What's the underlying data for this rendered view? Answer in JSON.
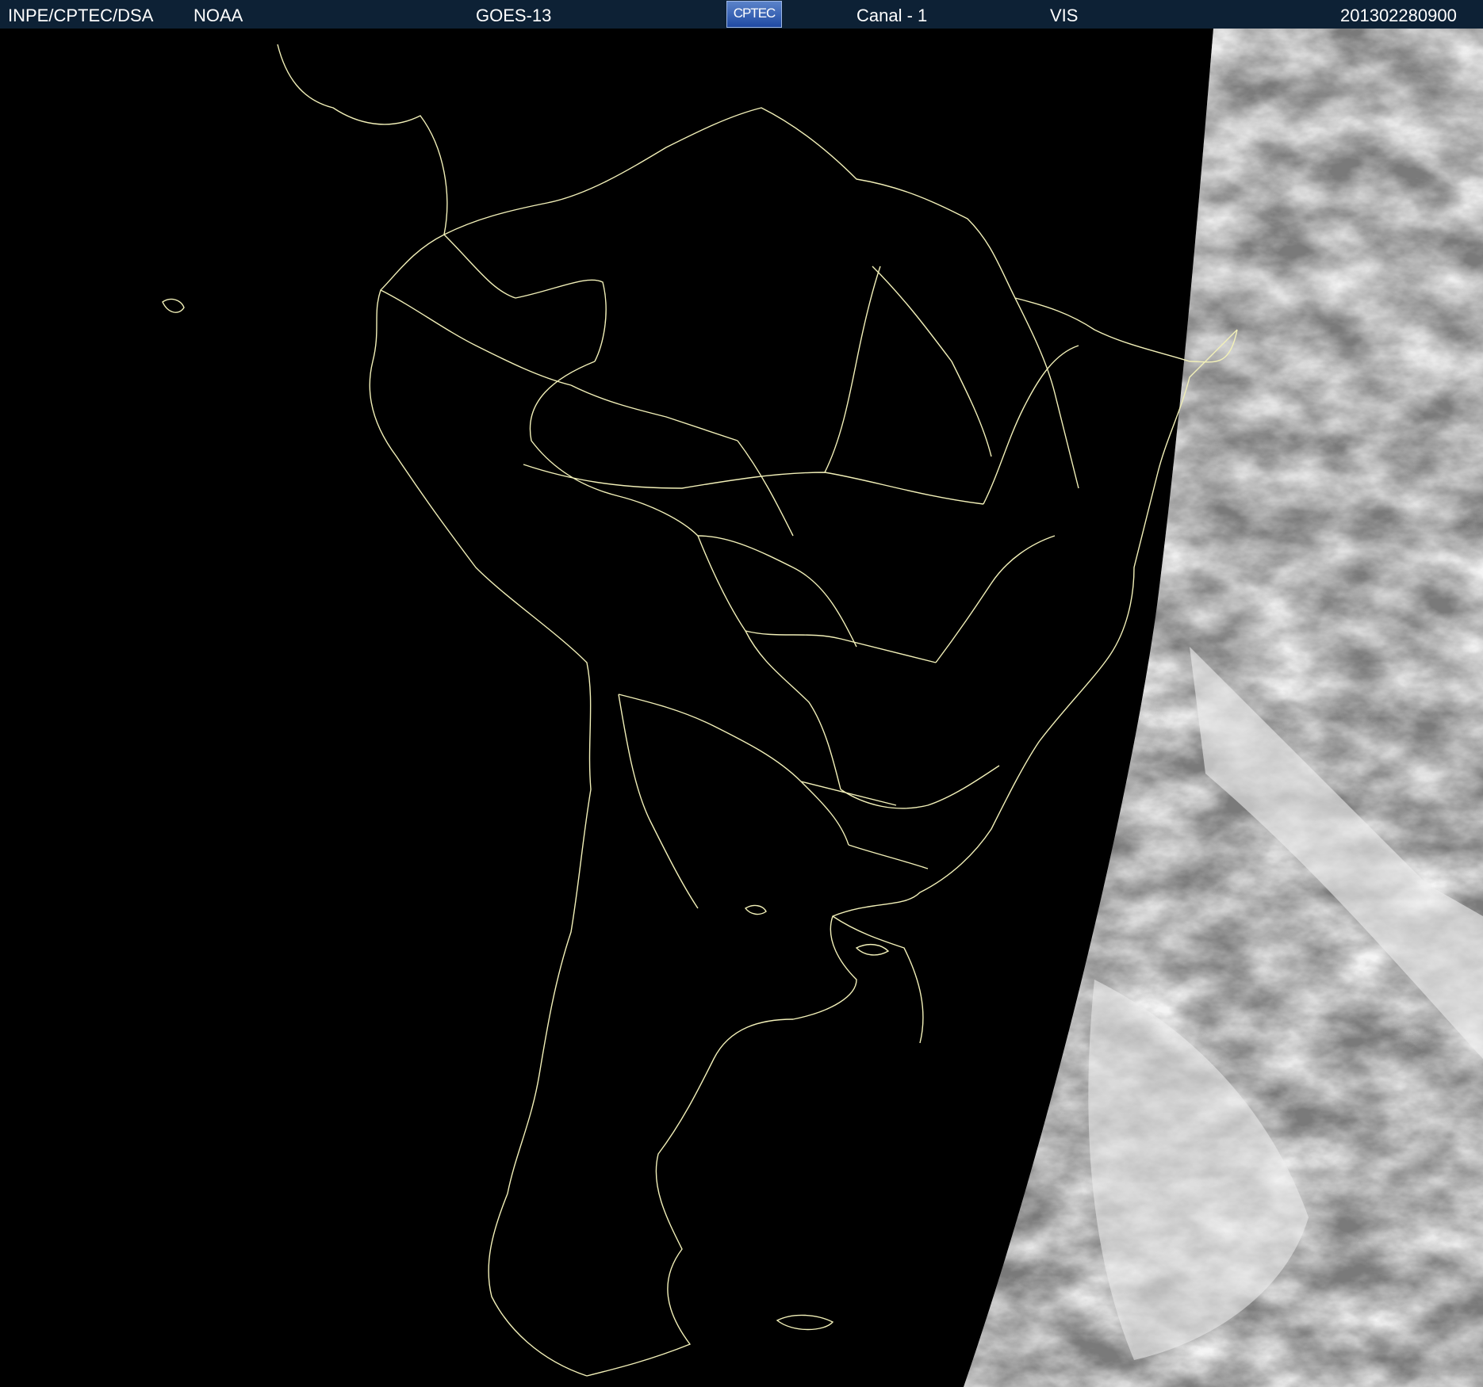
{
  "header": {
    "org": "INPE/CPTEC/DSA",
    "agency": "NOAA",
    "satellite": "GOES-13",
    "logo_text": "CPTEC",
    "channel": "Canal - 1",
    "band": "VIS",
    "timestamp": "201302280900"
  },
  "colors": {
    "header_bg": "#0d2135",
    "header_text": "#ffffff",
    "night_side": "#000000",
    "border_lines": "#f2f0b8",
    "cloud_light": "#e6e6e6",
    "cloud_dark": "#7a7a7a"
  },
  "map": {
    "projection": "satellite view, South America",
    "lit_region": "east (dawn terminator crossing Atlantic coast)"
  }
}
